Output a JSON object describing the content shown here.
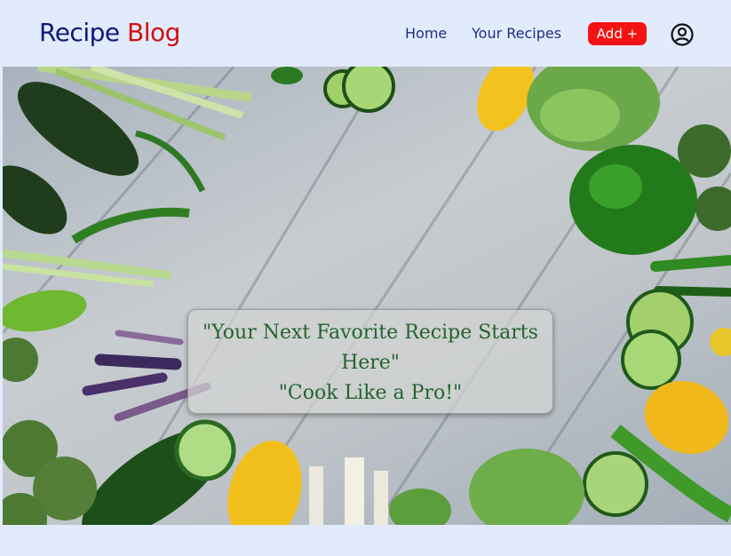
{
  "brand": {
    "part1": "Recipe",
    "part2": "Blog"
  },
  "nav": {
    "home": "Home",
    "your_recipes": "Your Recipes",
    "add": "Add +",
    "profile_icon": "user-circle-icon"
  },
  "hero": {
    "line1": "\"Your Next Favorite Recipe Starts",
    "line2": "Here\"",
    "line3": "\"Cook Like a Pro!\""
  },
  "colors": {
    "brand_dark": "#0d1a7a",
    "brand_red": "#d01010",
    "add_button": "#f41212",
    "tagline_text": "#236430",
    "background": "#e2ebfc"
  }
}
